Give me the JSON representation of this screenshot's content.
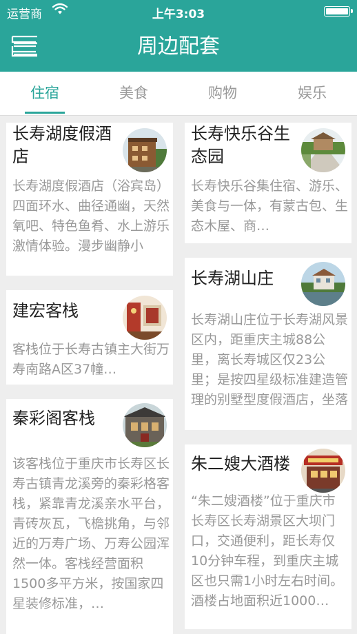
{
  "status_bar": {
    "carrier": "运营商",
    "time": "上午3:03"
  },
  "header": {
    "title": "周边配套"
  },
  "tabs": [
    {
      "label": "住宿",
      "active": true
    },
    {
      "label": "美食",
      "active": false
    },
    {
      "label": "购物",
      "active": false
    },
    {
      "label": "娱乐",
      "active": false
    }
  ],
  "colors": {
    "accent": "#2aa59a",
    "text_primary": "#222222",
    "text_secondary": "#999999"
  },
  "cards": [
    {
      "title": "长寿湖度假酒店",
      "description": "长寿湖度假酒店（浴宾岛）四面环水、曲径通幽，天然氧吧、特色鱼肴、水上游乐激情体验。漫步幽静小道，…",
      "image": "hotel-building-photo"
    },
    {
      "title": "建宏客栈",
      "description": "客栈位于长寿古镇主大街万寿南路A区37幢…",
      "image": "inn-lobby-photo"
    },
    {
      "title": "秦彩阁客栈",
      "description": "该客栈位于重庆市长寿区长寿古镇青龙溪旁的秦彩格客栈，紧靠青龙溪亲水平台，青砖灰瓦，飞檐挑角，与邻近的万寿广场、万寿公园浑然一体。客栈经营面积1500多平方米，按国家四星装修标准，…",
      "image": "inn-facade-photo"
    },
    {
      "title": "长寿快乐谷生态园",
      "description": "长寿快乐谷集住宿、游乐、美食与一体，有蒙古包、生态木屋、商…",
      "image": "eco-park-photo"
    },
    {
      "title": "长寿湖山庄",
      "description": "长寿湖山庄位于长寿湖风景区内，距重庆主城88公里，离长寿城区仅23公里；是按四星级标准建造管理的别墅型度假酒店，坐落于…",
      "image": "lake-villa-photo"
    },
    {
      "title": "朱二嫂大酒楼",
      "description": "“朱二嫂酒楼”位于重庆市长寿区长寿湖景区大坝门口，交通便利，距长寿仅10分钟车程，到重庆主城区也只需1小时左右时间。酒楼占地面积近1000…",
      "image": "restaurant-sign-photo"
    }
  ]
}
